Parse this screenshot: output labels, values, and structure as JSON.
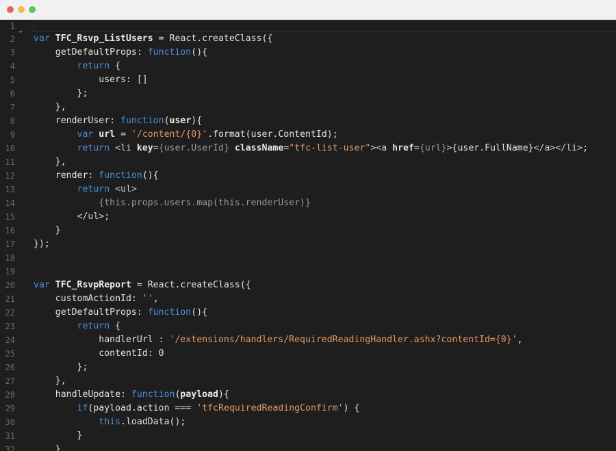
{
  "window": {
    "controls": {
      "close_color": "#e0665c",
      "minimize_color": "#f0be4a",
      "maximize_color": "#5fc456"
    }
  },
  "colors": {
    "background": "#1e1e1e",
    "keyword": "#4a90d9",
    "string": "#e59965",
    "text": "#e2e2e2",
    "line_number": "#6a6a6a"
  },
  "editor": {
    "lines": [
      {
        "num": "1",
        "tokens": []
      },
      {
        "num": "2",
        "tokens": [
          {
            "t": "kw",
            "v": "var "
          },
          {
            "t": "def",
            "v": "TFC_Rsvp_ListUsers"
          },
          {
            "t": "txt",
            "v": " = React.createClass({"
          }
        ]
      },
      {
        "num": "3",
        "tokens": [
          {
            "t": "txt",
            "v": "    getDefaultProps: "
          },
          {
            "t": "kw",
            "v": "function"
          },
          {
            "t": "txt",
            "v": "(){"
          }
        ]
      },
      {
        "num": "4",
        "tokens": [
          {
            "t": "txt",
            "v": "        "
          },
          {
            "t": "kw",
            "v": "return"
          },
          {
            "t": "txt",
            "v": " {"
          }
        ]
      },
      {
        "num": "5",
        "tokens": [
          {
            "t": "txt",
            "v": "            users: []"
          }
        ]
      },
      {
        "num": "6",
        "tokens": [
          {
            "t": "txt",
            "v": "        };"
          }
        ]
      },
      {
        "num": "7",
        "tokens": [
          {
            "t": "txt",
            "v": "    },"
          }
        ]
      },
      {
        "num": "8",
        "tokens": [
          {
            "t": "txt",
            "v": "    renderUser: "
          },
          {
            "t": "kw",
            "v": "function"
          },
          {
            "t": "txt",
            "v": "("
          },
          {
            "t": "def",
            "v": "user"
          },
          {
            "t": "txt",
            "v": "){"
          }
        ]
      },
      {
        "num": "9",
        "tokens": [
          {
            "t": "txt",
            "v": "        "
          },
          {
            "t": "kw",
            "v": "var "
          },
          {
            "t": "def",
            "v": "url"
          },
          {
            "t": "txt",
            "v": " = "
          },
          {
            "t": "str",
            "v": "'/content/{0}'"
          },
          {
            "t": "txt",
            "v": ".format(user.ContentId);"
          }
        ]
      },
      {
        "num": "10",
        "tokens": [
          {
            "t": "txt",
            "v": "        "
          },
          {
            "t": "kw",
            "v": "return"
          },
          {
            "t": "txt",
            "v": " "
          },
          {
            "t": "tag",
            "v": "<li "
          },
          {
            "t": "attr",
            "v": "key"
          },
          {
            "t": "txt",
            "v": "="
          },
          {
            "t": "expr",
            "v": "{user.UserId}"
          },
          {
            "t": "txt",
            "v": " "
          },
          {
            "t": "attr",
            "v": "className"
          },
          {
            "t": "txt",
            "v": "="
          },
          {
            "t": "str",
            "v": "\"tfc-list-user\""
          },
          {
            "t": "tag",
            "v": "><a "
          },
          {
            "t": "attr",
            "v": "href"
          },
          {
            "t": "txt",
            "v": "="
          },
          {
            "t": "expr",
            "v": "{url}"
          },
          {
            "t": "tag",
            "v": ">"
          },
          {
            "t": "txt",
            "v": "{user.FullName}"
          },
          {
            "t": "tag",
            "v": "</a></li>"
          },
          {
            "t": "txt",
            "v": ";"
          }
        ]
      },
      {
        "num": "11",
        "tokens": [
          {
            "t": "txt",
            "v": "    },"
          }
        ]
      },
      {
        "num": "12",
        "tokens": [
          {
            "t": "txt",
            "v": "    render: "
          },
          {
            "t": "kw",
            "v": "function"
          },
          {
            "t": "txt",
            "v": "(){"
          }
        ]
      },
      {
        "num": "13",
        "tokens": [
          {
            "t": "txt",
            "v": "        "
          },
          {
            "t": "kw",
            "v": "return"
          },
          {
            "t": "txt",
            "v": " "
          },
          {
            "t": "tag",
            "v": "<ul>"
          }
        ]
      },
      {
        "num": "14",
        "tokens": [
          {
            "t": "txt",
            "v": "            "
          },
          {
            "t": "expr",
            "v": "{this.props.users.map(this.renderUser)}"
          }
        ]
      },
      {
        "num": "15",
        "tokens": [
          {
            "t": "txt",
            "v": "        "
          },
          {
            "t": "tag",
            "v": "</ul>"
          },
          {
            "t": "txt",
            "v": ";"
          }
        ]
      },
      {
        "num": "16",
        "tokens": [
          {
            "t": "txt",
            "v": "    }"
          }
        ]
      },
      {
        "num": "17",
        "tokens": [
          {
            "t": "txt",
            "v": "});"
          }
        ]
      },
      {
        "num": "18",
        "tokens": []
      },
      {
        "num": "19",
        "tokens": []
      },
      {
        "num": "20",
        "tokens": [
          {
            "t": "kw",
            "v": "var "
          },
          {
            "t": "def",
            "v": "TFC_RsvpReport"
          },
          {
            "t": "txt",
            "v": " = React.createClass({"
          }
        ]
      },
      {
        "num": "21",
        "tokens": [
          {
            "t": "txt",
            "v": "    customActionId: "
          },
          {
            "t": "str",
            "v": "''"
          },
          {
            "t": "txt",
            "v": ","
          }
        ]
      },
      {
        "num": "22",
        "tokens": [
          {
            "t": "txt",
            "v": "    getDefaultProps: "
          },
          {
            "t": "kw",
            "v": "function"
          },
          {
            "t": "txt",
            "v": "(){"
          }
        ]
      },
      {
        "num": "23",
        "tokens": [
          {
            "t": "txt",
            "v": "        "
          },
          {
            "t": "kw",
            "v": "return"
          },
          {
            "t": "txt",
            "v": " {"
          }
        ]
      },
      {
        "num": "24",
        "tokens": [
          {
            "t": "txt",
            "v": "            handlerUrl : "
          },
          {
            "t": "str",
            "v": "'/extensions/handlers/RequiredReadingHandler.ashx?contentId={0}'"
          },
          {
            "t": "txt",
            "v": ","
          }
        ]
      },
      {
        "num": "25",
        "tokens": [
          {
            "t": "txt",
            "v": "            contentId: 0"
          }
        ]
      },
      {
        "num": "26",
        "tokens": [
          {
            "t": "txt",
            "v": "        };"
          }
        ]
      },
      {
        "num": "27",
        "tokens": [
          {
            "t": "txt",
            "v": "    },"
          }
        ]
      },
      {
        "num": "28",
        "tokens": [
          {
            "t": "txt",
            "v": "    handleUpdate: "
          },
          {
            "t": "kw",
            "v": "function"
          },
          {
            "t": "txt",
            "v": "("
          },
          {
            "t": "def",
            "v": "payload"
          },
          {
            "t": "txt",
            "v": "){"
          }
        ]
      },
      {
        "num": "29",
        "tokens": [
          {
            "t": "txt",
            "v": "        "
          },
          {
            "t": "kw",
            "v": "if"
          },
          {
            "t": "txt",
            "v": "(payload.action === "
          },
          {
            "t": "str",
            "v": "'tfcRequiredReadingConfirm'"
          },
          {
            "t": "txt",
            "v": ") {"
          }
        ]
      },
      {
        "num": "30",
        "tokens": [
          {
            "t": "txt",
            "v": "            "
          },
          {
            "t": "kw",
            "v": "this"
          },
          {
            "t": "txt",
            "v": ".loadData();"
          }
        ]
      },
      {
        "num": "31",
        "tokens": [
          {
            "t": "txt",
            "v": "        }"
          }
        ]
      },
      {
        "num": "32",
        "tokens": [
          {
            "t": "txt",
            "v": "    }"
          }
        ]
      }
    ]
  }
}
